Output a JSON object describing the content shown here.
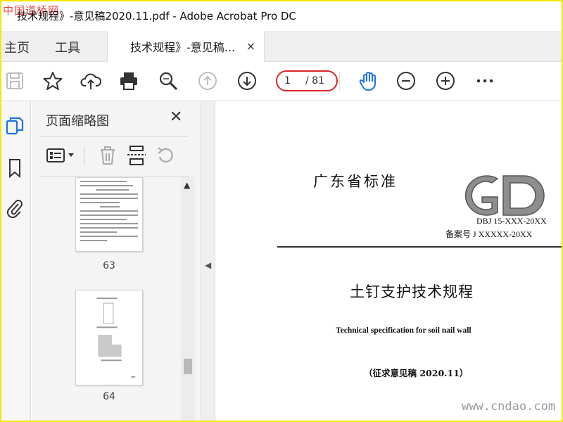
{
  "watermark": {
    "logo_text": "中国道桥网",
    "url": "www.cndao.com"
  },
  "window": {
    "title": "技术规程》-意见稿2020.11.pdf - Adobe Acrobat Pro DC"
  },
  "tabs": {
    "home_label": "主页",
    "tools_label": "工具",
    "document_label": "技术规程》-意见稿...",
    "close_glyph": "×"
  },
  "toolbar": {
    "icons": [
      "save-icon",
      "bookmark-star-icon",
      "upload-icon",
      "print-icon",
      "zoom-search-icon",
      "page-up-icon",
      "page-down-icon",
      "hand-tool-icon",
      "zoom-out-icon",
      "zoom-in-icon",
      "more-icon"
    ],
    "current_page": "1",
    "total_pages": "/ 81",
    "accent_color": "#1a73e8",
    "highlight_color": "#d8262b"
  },
  "rail": {
    "icons": [
      "pages-icon",
      "bookmark-icon",
      "attachment-icon"
    ]
  },
  "thumbnails": {
    "header": "页面缩略图",
    "close_glyph": "✕",
    "tools": [
      "options-icon",
      "delete-icon",
      "extract-icon",
      "rotate-icon"
    ],
    "pages": [
      {
        "label": "63"
      },
      {
        "label": "64"
      }
    ]
  },
  "document": {
    "standard_heading": "广东省标准",
    "logo_letters": "GD",
    "code": "DBJ 15-XXX-20XX",
    "record_number": "备案号  J XXXXX-20XX",
    "title_cn": "土钉支护技术规程",
    "title_en": "Technical specification for soil nail wall",
    "draft_note": "（征求意见稿 2020.11）"
  }
}
